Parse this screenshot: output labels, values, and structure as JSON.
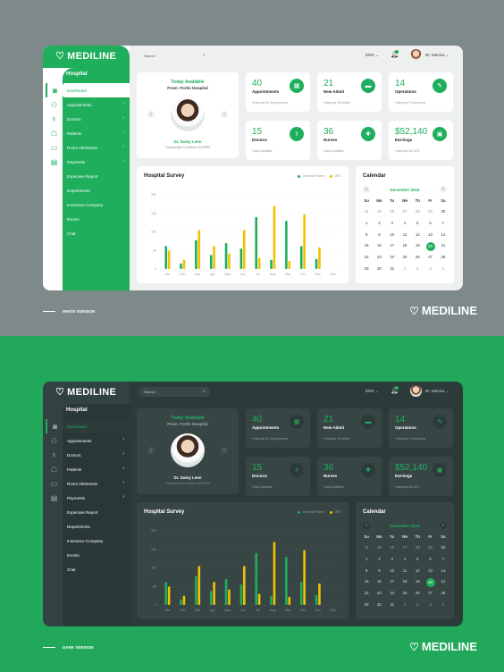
{
  "brand": "MEDILINE",
  "versions": [
    {
      "id": "light",
      "caption": "WHITE VERSION"
    },
    {
      "id": "dark",
      "caption": "DARK VERSION"
    }
  ],
  "sidebar": {
    "section": "Hospital",
    "items": [
      {
        "label": "Dashboard",
        "icon": "camera-icon",
        "active": true
      },
      {
        "label": "Appointments",
        "icon": "people-icon",
        "chevron": true
      },
      {
        "label": "Doctors",
        "icon": "doctor-icon",
        "chevron": true
      },
      {
        "label": "Patients",
        "icon": "patient-icon",
        "chevron": true
      },
      {
        "label": "Room Allotments",
        "icon": "monitor-icon",
        "chevron": true
      },
      {
        "label": "Payments",
        "icon": "card-icon",
        "chevron": true
      },
      {
        "label": "Expenses Report"
      },
      {
        "label": "Departments"
      },
      {
        "label": "Insurance Company"
      },
      {
        "label": "Events"
      },
      {
        "label": "Chat"
      }
    ]
  },
  "topbar": {
    "search_placeholder": "Search",
    "lang": "ENG",
    "user": "Dr. Monica"
  },
  "doctor_card": {
    "title": "Today Available",
    "subtitle": "From: Fortis Hospital",
    "name": "Dr. Daisy Leen",
    "spec_label": "Orthopedist",
    "spec_time": "11:00AM–03:00PM"
  },
  "stats": [
    {
      "value": "40",
      "label": "Appointments",
      "sub": "Yesterday 32 Appointments",
      "icon": "calendar-icon"
    },
    {
      "value": "21",
      "label": "New Admit",
      "sub": "Yesterday 18 Admits",
      "icon": "bed-icon"
    },
    {
      "value": "14",
      "label": "Operations",
      "sub": "Yesterday 9 Operations",
      "icon": "scalpel-icon"
    },
    {
      "value": "15",
      "label": "Doctors",
      "sub": "Today Available",
      "icon": "doctor-icon"
    },
    {
      "value": "36",
      "label": "Nurses",
      "sub": "Today Available",
      "icon": "nurse-icon"
    },
    {
      "value": "$52,140",
      "label": "Earnings",
      "sub": "Yesterday $61,876",
      "icon": "cash-icon"
    }
  ],
  "colors": {
    "green": "#1fae5b",
    "yellow": "#f2c200"
  },
  "chart_data": {
    "type": "bar",
    "title": "Hospital Survey",
    "legend": [
      "General Patient",
      "OPD"
    ],
    "legend_position": "top-right",
    "categories": [
      "Jan",
      "Feb",
      "Mar",
      "Apr",
      "May",
      "Jun",
      "Jul",
      "Aug",
      "Sep",
      "Oct",
      "Nov",
      "Dec"
    ],
    "yticks": [
      "200",
      "150",
      "100",
      "50",
      "0"
    ],
    "ylim": [
      0,
      200
    ],
    "grid": true,
    "series": [
      {
        "name": "General Patient",
        "values": [
          62,
          15,
          78,
          38,
          70,
          55,
          140,
          25,
          130,
          62,
          27,
          0
        ]
      },
      {
        "name": "OPD",
        "values": [
          50,
          25,
          105,
          62,
          42,
          105,
          30,
          170,
          22,
          148,
          58,
          0
        ]
      }
    ]
  },
  "calendar": {
    "title": "Calendar",
    "month": "December 2019",
    "weekdays": [
      "Su",
      "Mo",
      "Tu",
      "We",
      "Th",
      "Fr",
      "Sa"
    ],
    "days": [
      "24",
      "25",
      "26",
      "27",
      "28",
      "29",
      "30",
      "1",
      "2",
      "3",
      "4",
      "5",
      "6",
      "7",
      "8",
      "9",
      "10",
      "11",
      "12",
      "13",
      "14",
      "15",
      "16",
      "17",
      "18",
      "19",
      "20",
      "21",
      "22",
      "23",
      "24",
      "25",
      "26",
      "27",
      "28",
      "29",
      "30",
      "31",
      "1",
      "2",
      "3",
      "4"
    ],
    "muted_first": 6,
    "muted_last_from": 38,
    "selected": "20"
  }
}
